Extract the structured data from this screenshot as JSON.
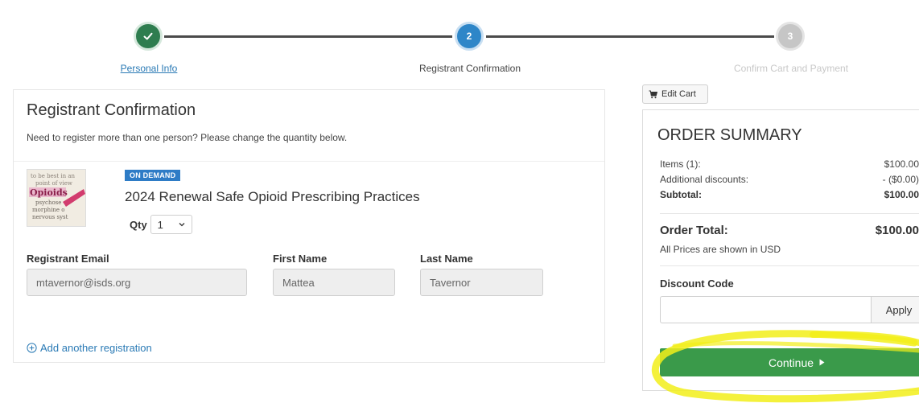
{
  "stepper": {
    "steps": [
      {
        "label": "Personal Info",
        "number": "",
        "state": "complete"
      },
      {
        "label": "Registrant Confirmation",
        "number": "2",
        "state": "active"
      },
      {
        "label": "Confirm Cart and Payment",
        "number": "3",
        "state": "pending"
      }
    ]
  },
  "main": {
    "title": "Registrant Confirmation",
    "subtitle": "Need to register more than one person? Please change the quantity below.",
    "item": {
      "thumbnail_words": [
        "to be best in an",
        "point of view",
        "Opioids",
        "psychose",
        "morphine o",
        "nervous syst"
      ],
      "badge": "ON DEMAND",
      "course_title": "2024 Renewal Safe Opioid Prescribing Practices",
      "qty_label": "Qty",
      "qty_value": "1"
    },
    "fields": {
      "email_label": "Registrant Email",
      "email_value": "mtavernor@isds.org",
      "first_label": "First Name",
      "first_value": "Mattea",
      "last_label": "Last Name",
      "last_value": "Tavernor"
    },
    "add_link": "Add another registration"
  },
  "cart": {
    "edit_label": "Edit Cart"
  },
  "summary": {
    "title": "ORDER SUMMARY",
    "items_label": "Items (1):",
    "items_value": "$100.00",
    "discounts_label": "Additional discounts:",
    "discounts_value": "- ($0.00)",
    "subtotal_label": "Subtotal:",
    "subtotal_value": "$100.00",
    "total_label": "Order Total:",
    "total_value": "$100.00",
    "usd_note": "All Prices are shown in USD",
    "discount_code_label": "Discount Code",
    "discount_code_value": "",
    "apply_label": "Apply",
    "continue_label": "Continue"
  },
  "colors": {
    "accent_blue": "#2e86c8",
    "complete_green": "#2e7d4f",
    "continue_green": "#3a9a4a",
    "highlight_yellow": "#f2ee1a"
  }
}
